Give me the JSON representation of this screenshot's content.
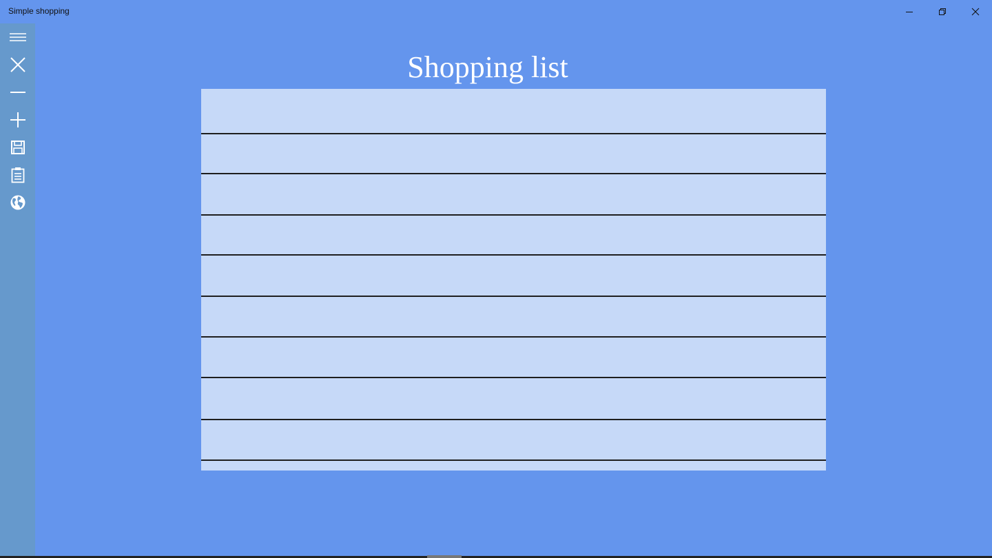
{
  "window": {
    "title": "Simple shopping",
    "controls": [
      "minimize-icon",
      "restore-icon",
      "close-icon"
    ]
  },
  "sidebar": {
    "background": "#6699CC",
    "items": [
      {
        "icon": "hamburger-menu-icon"
      },
      {
        "icon": "close-icon"
      },
      {
        "icon": "minus-icon"
      },
      {
        "icon": "plus-icon"
      },
      {
        "icon": "save-icon"
      },
      {
        "icon": "clipboard-icon"
      },
      {
        "icon": "globe-icon"
      }
    ]
  },
  "main": {
    "heading": "Shopping list",
    "background": "#6495ED",
    "list_background": "#C6D9F8",
    "list_rows": 10
  }
}
